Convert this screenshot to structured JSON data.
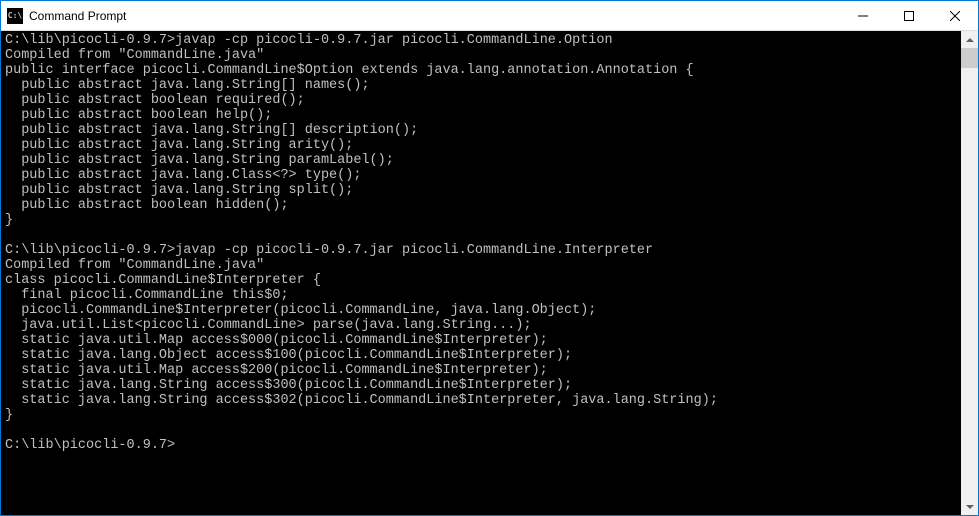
{
  "window": {
    "title": "Command Prompt",
    "icon_label": "C:\\"
  },
  "terminal": {
    "line1_prompt": "C:\\lib\\picocli-0.9.7>",
    "line1_cmd": "javap -cp picocli-0.9.7.jar picocli.CommandLine.Option",
    "line2": "Compiled from \"CommandLine.java\"",
    "line3": "public interface picocli.CommandLine$Option extends java.lang.annotation.Annotation {",
    "line4": "  public abstract java.lang.String[] names();",
    "line5": "  public abstract boolean required();",
    "line6": "  public abstract boolean help();",
    "line7": "  public abstract java.lang.String[] description();",
    "line8": "  public abstract java.lang.String arity();",
    "line9": "  public abstract java.lang.String paramLabel();",
    "line10": "  public abstract java.lang.Class<?> type();",
    "line11": "  public abstract java.lang.String split();",
    "line12": "  public abstract boolean hidden();",
    "line13": "}",
    "line14": "",
    "line15_prompt": "C:\\lib\\picocli-0.9.7>",
    "line15_cmd": "javap -cp picocli-0.9.7.jar picocli.CommandLine.Interpreter",
    "line16": "Compiled from \"CommandLine.java\"",
    "line17": "class picocli.CommandLine$Interpreter {",
    "line18": "  final picocli.CommandLine this$0;",
    "line19": "  picocli.CommandLine$Interpreter(picocli.CommandLine, java.lang.Object);",
    "line20": "  java.util.List<picocli.CommandLine> parse(java.lang.String...);",
    "line21": "  static java.util.Map access$000(picocli.CommandLine$Interpreter);",
    "line22": "  static java.lang.Object access$100(picocli.CommandLine$Interpreter);",
    "line23": "  static java.util.Map access$200(picocli.CommandLine$Interpreter);",
    "line24": "  static java.lang.String access$300(picocli.CommandLine$Interpreter);",
    "line25": "  static java.lang.String access$302(picocli.CommandLine$Interpreter, java.lang.String);",
    "line26": "}",
    "line27": "",
    "line28_prompt": "C:\\lib\\picocli-0.9.7>"
  }
}
